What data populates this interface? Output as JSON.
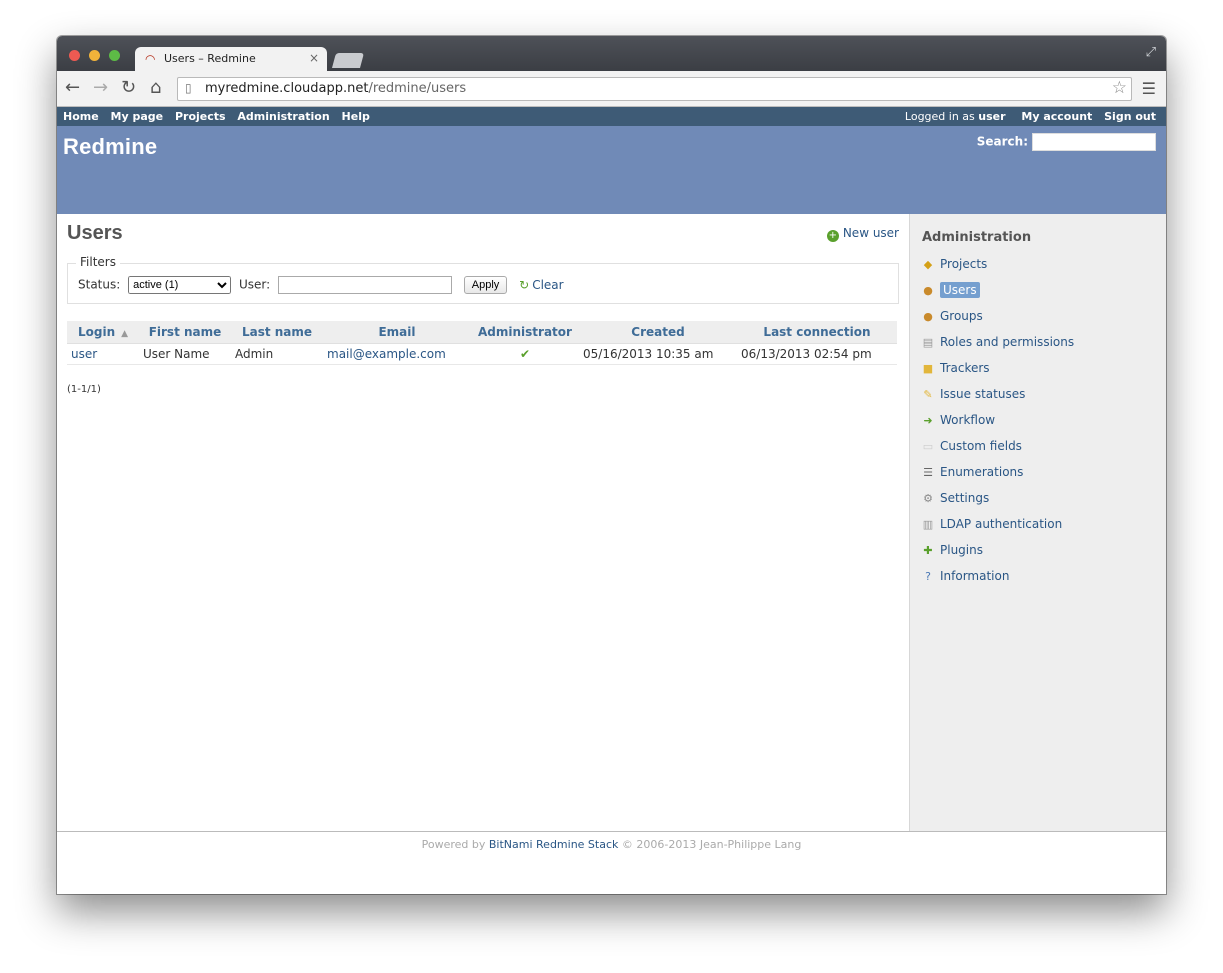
{
  "browser": {
    "tab_title": "Users – Redmine",
    "tab_close": "×",
    "url_host": "myredmine.cloudapp.net",
    "url_path": "/redmine/users"
  },
  "topmenu": {
    "items": [
      "Home",
      "My page",
      "Projects",
      "Administration",
      "Help"
    ],
    "logged_as_prefix": "Logged in as",
    "logged_as_user": "user",
    "my_account": "My account",
    "sign_out": "Sign out"
  },
  "header": {
    "title": "Redmine",
    "search_label": "Search:"
  },
  "content": {
    "title": "Users",
    "new_user": "New user",
    "filters": {
      "legend": "Filters",
      "status_label": "Status:",
      "status_value": "active (1)",
      "user_label": "User:",
      "user_value": "",
      "apply": "Apply",
      "clear": "Clear"
    },
    "table": {
      "headers": [
        "Login",
        "First name",
        "Last name",
        "Email",
        "Administrator",
        "Created",
        "Last connection"
      ],
      "rows": [
        {
          "login": "user",
          "first_name": "User Name",
          "last_name": "Admin",
          "email": "mail@example.com",
          "admin": "✔",
          "created": "05/16/2013 10:35 am",
          "last_connection": "06/13/2013 02:54 pm"
        }
      ]
    },
    "pagination": "(1-1/1)"
  },
  "sidebar": {
    "title": "Administration",
    "items": [
      {
        "label": "Projects",
        "icon": "projects-icon"
      },
      {
        "label": "Users",
        "icon": "user-icon"
      },
      {
        "label": "Groups",
        "icon": "group-icon"
      },
      {
        "label": "Roles and permissions",
        "icon": "roles-icon"
      },
      {
        "label": "Trackers",
        "icon": "tracker-icon"
      },
      {
        "label": "Issue statuses",
        "icon": "issue-status-icon"
      },
      {
        "label": "Workflow",
        "icon": "workflow-icon"
      },
      {
        "label": "Custom fields",
        "icon": "custom-fields-icon"
      },
      {
        "label": "Enumerations",
        "icon": "list-icon"
      },
      {
        "label": "Settings",
        "icon": "gear-icon"
      },
      {
        "label": "LDAP authentication",
        "icon": "server-key-icon"
      },
      {
        "label": "Plugins",
        "icon": "plugin-icon"
      },
      {
        "label": "Information",
        "icon": "help-icon"
      }
    ]
  },
  "footer": {
    "prefix": "Powered by",
    "link": "BitNami Redmine Stack",
    "suffix": "© 2006-2013 Jean-Philippe Lang"
  }
}
